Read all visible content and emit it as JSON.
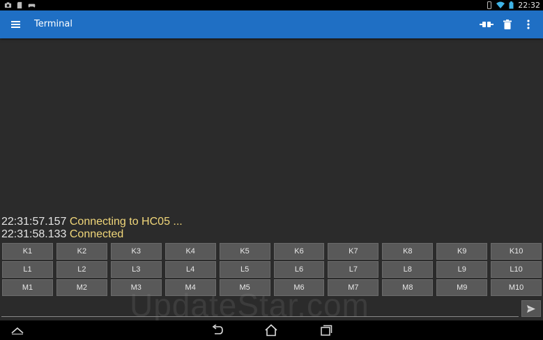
{
  "status_bar": {
    "time": "22:32",
    "left_icons": [
      "camera-icon",
      "sd-card-icon",
      "gamepad-icon"
    ],
    "right_icons": [
      "vibrate-icon",
      "wifi-icon",
      "battery-icon"
    ]
  },
  "action_bar": {
    "title": "Terminal",
    "color": "#1f6fc4",
    "actions": [
      "connect-icon",
      "trash-icon",
      "overflow-menu-icon"
    ]
  },
  "terminal": {
    "lines": [
      {
        "timestamp": "22:31:57.157",
        "message": "Connecting to HC05 ..."
      },
      {
        "timestamp": "22:31:58.133",
        "message": "Connected"
      }
    ],
    "timestamp_color": "#e4e4e4",
    "message_color": "#f1d77a"
  },
  "macros": {
    "rows": [
      [
        "K1",
        "K2",
        "K3",
        "K4",
        "K5",
        "K6",
        "K7",
        "K8",
        "K9",
        "K10"
      ],
      [
        "L1",
        "L2",
        "L3",
        "L4",
        "L5",
        "L6",
        "L7",
        "L8",
        "L9",
        "L10"
      ],
      [
        "M1",
        "M2",
        "M3",
        "M4",
        "M5",
        "M6",
        "M7",
        "M8",
        "M9",
        "M10"
      ]
    ]
  },
  "input": {
    "value": "",
    "placeholder": ""
  },
  "watermark": "UpdateStar.com",
  "nav_bar": {
    "buttons": [
      "up-chevron-icon",
      "back-icon",
      "home-icon",
      "recents-icon"
    ]
  }
}
